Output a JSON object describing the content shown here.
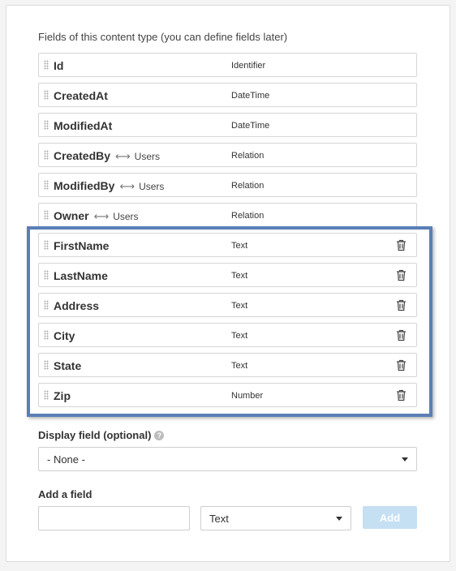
{
  "intro_text": "Fields of this content type (you can define fields later)",
  "fixed_fields": [
    {
      "name": "Id",
      "type": "Identifier",
      "relation": ""
    },
    {
      "name": "CreatedAt",
      "type": "DateTime",
      "relation": ""
    },
    {
      "name": "ModifiedAt",
      "type": "DateTime",
      "relation": ""
    },
    {
      "name": "CreatedBy",
      "type": "Relation",
      "relation": "Users"
    },
    {
      "name": "ModifiedBy",
      "type": "Relation",
      "relation": "Users"
    },
    {
      "name": "Owner",
      "type": "Relation",
      "relation": "Users"
    }
  ],
  "custom_fields": [
    {
      "name": "FirstName",
      "type": "Text"
    },
    {
      "name": "LastName",
      "type": "Text"
    },
    {
      "name": "Address",
      "type": "Text"
    },
    {
      "name": "City",
      "type": "Text"
    },
    {
      "name": "State",
      "type": "Text"
    },
    {
      "name": "Zip",
      "type": "Number"
    }
  ],
  "relation_arrow": "⟷",
  "display_field": {
    "label": "Display field (optional)",
    "help_icon": "?",
    "value": "- None -"
  },
  "add_field": {
    "label": "Add a field",
    "name_value": "",
    "type_value": "Text",
    "button_label": "Add"
  },
  "colors": {
    "highlight_border": "#5a7fb6",
    "add_button_bg": "#c5dff3"
  }
}
